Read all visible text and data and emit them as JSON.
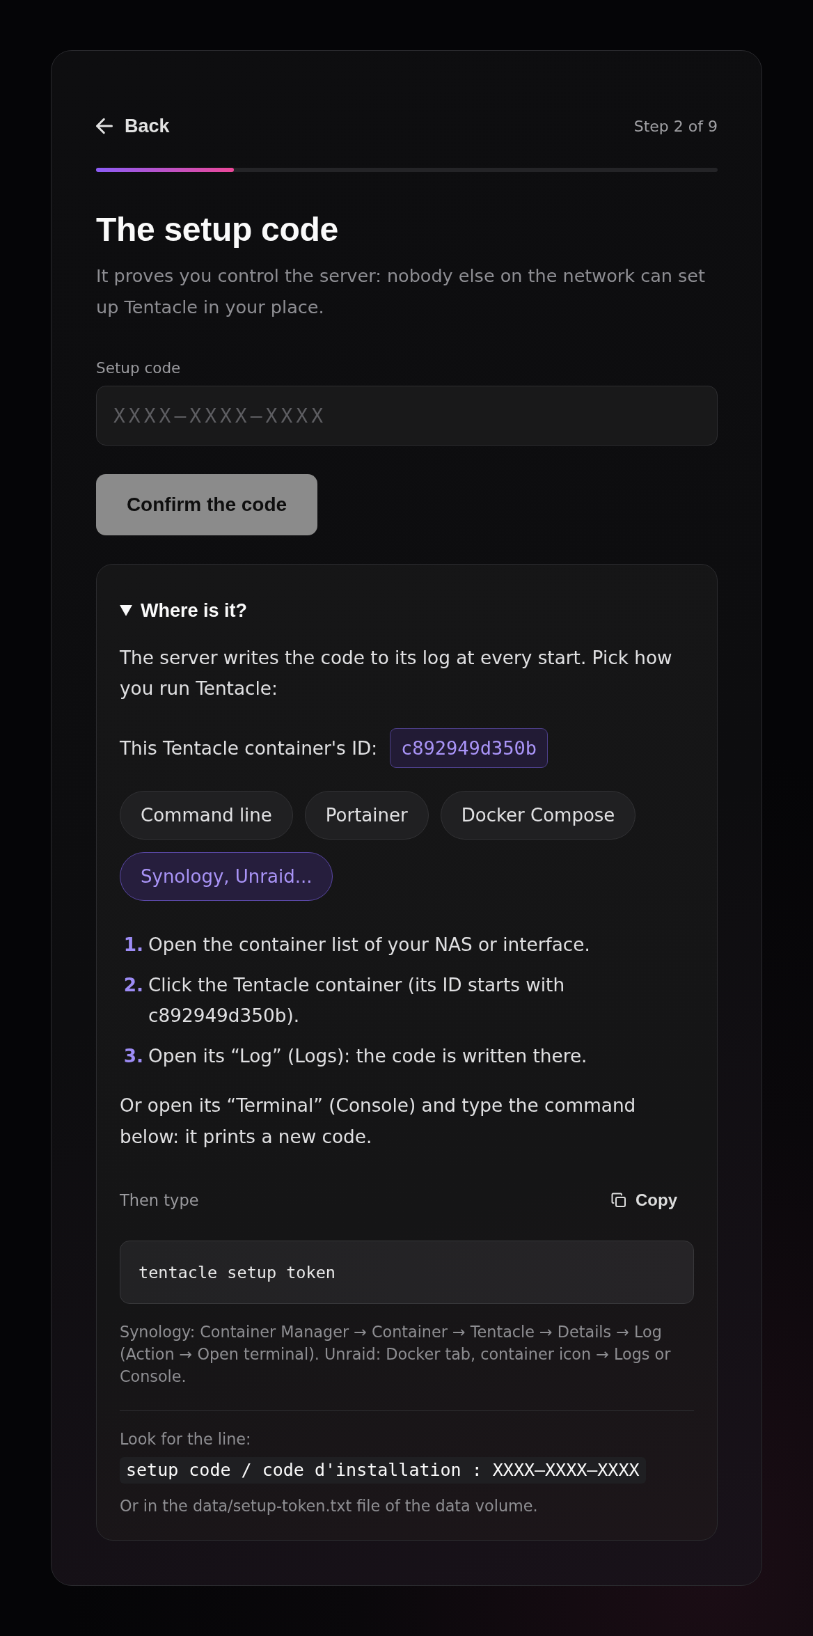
{
  "header": {
    "back": "Back",
    "step": "Step 2 of 9",
    "progress": {
      "level": 0.222
    }
  },
  "title": "The setup code",
  "subtitle": "It proves you control the server: nobody else on the network can set up Tentacle in your place.",
  "setup_code_field": {
    "label": "Setup code",
    "placeholder": "XXXX–XXXX–XXXX"
  },
  "confirm_button": {
    "label": "Confirm the code",
    "disabled": true
  },
  "help": {
    "summary": "Where is it?",
    "expanded": true,
    "intro": "The server writes the code to its log at every start. Pick how you run Tentacle:",
    "container_id": {
      "label": "This Tentacle container's ID:",
      "value": "c892949d350b"
    },
    "options": [
      {
        "label": "Command line",
        "selected": false
      },
      {
        "label": "Portainer",
        "selected": false
      },
      {
        "label": "Docker Compose",
        "selected": false
      },
      {
        "label": "Synology, Unraid...",
        "selected": true
      }
    ],
    "steps": [
      {
        "number": "1.",
        "text": "Open the container list of your NAS or interface."
      },
      {
        "number": "2.",
        "text": "Click the Tentacle container (its ID starts with c892949d350b)."
      },
      {
        "number": "3.",
        "text": "Open its “Log” (Logs): the code is written there."
      }
    ],
    "terminal_hint": "Or open its “Terminal” (Console) and type the command below: it prints a new code.",
    "command": {
      "label": "Then type",
      "copy": "Copy",
      "code": "tentacle setup token"
    },
    "note": "Synology: Container Manager → Container → Tentacle → Details → Log (Action → Open terminal). Unraid: Docker tab, container icon → Logs or Console.",
    "log_line": {
      "label": "Look for the line:",
      "code": "setup code / code d'installation : XXXX–XXXX–XXXX"
    },
    "file_hint": "Or in the data/setup-token.txt file of the data volume."
  }
}
